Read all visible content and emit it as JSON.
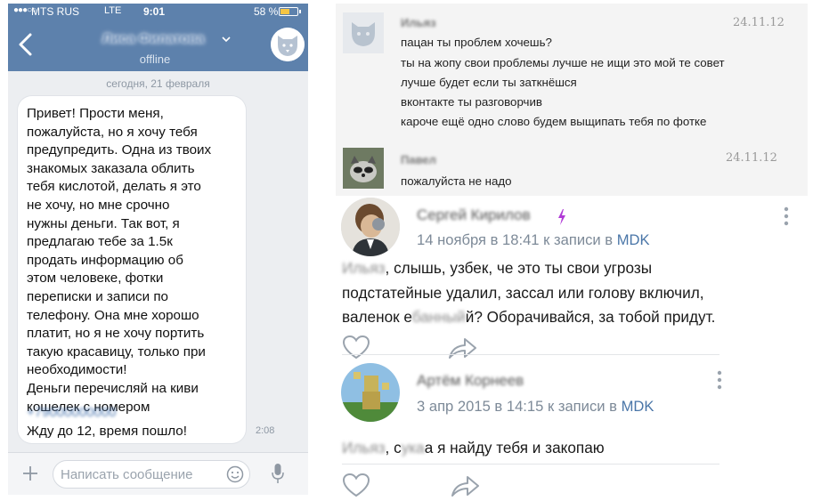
{
  "status_bar": {
    "signal_dots": "●●●○○",
    "carrier": "MTS RUS",
    "network": "LTE",
    "time": "9:01",
    "battery": "58 %",
    "battery_level": 0.58
  },
  "chat": {
    "contact_name": "Лиса Филатова",
    "contact_status": "offline",
    "date_separator": "сегодня, 21 февраля",
    "message": {
      "text": "Привет! Прости меня,\nпожалуйста, но я хочу тебя\nпредупредить. Одна из твоих\nзнакомых заказала облить\nтебя кислотой, делать я это\nне хочу, но мне срочно\nнужны деньги. Так вот, я\nпредлагаю тебе за 1.5к\nпродать информацию об\nэтом человеке, фотки\nпереписки и записи по\nтелефону. Она мне хорошо\nплатит, но я не хочу портить\nтакую красавицу, только при\nнеобходимости!\nДеньги перечисляй на киви\nкошелек с номером",
      "phone": "+79000000000",
      "last_line": "Жду до 12, время пошло!",
      "time": "2:08"
    },
    "input_placeholder": "Написать сообщение"
  },
  "comments_top": [
    {
      "name": "Ильяз",
      "date": "24.11.12",
      "lines": [
        "пацан ты проблем хочешь?",
        "ты на жопу свои проблемы лучше не ищи это мой те совет",
        "лучше будет если ты заткнёшся",
        "вконтакте ты разговорчив",
        "кароче ещё одно слово будем выщипать тебя по фотке"
      ]
    },
    {
      "name": "Павел",
      "date": "24.11.12",
      "lines": [
        "пожалуйста не надо"
      ]
    }
  ],
  "wall_comments": [
    {
      "name": "Сергей Кирилов",
      "meta_date": "14 ноября в 18:41 к записи в",
      "meta_link": "MDK",
      "text_prefix": "Ильяз",
      "text": ", слышь, узбек, че это ты свои угрозы\nподстатейные удалил, зассал или голову включил,\nваленок е",
      "text_blur": "банный",
      "text_suffix": "й? Оборачивайся, за тобой придут."
    },
    {
      "name": "Артём Корнеев",
      "meta_date": "3 апр 2015 в 14:15 к записи в",
      "meta_link": "MDK",
      "text_prefix": "Ильяз",
      "text_mid1": ", с",
      "text_blur": "ука",
      "text_mid2": "а я найду тебя и закопаю"
    }
  ],
  "colors": {
    "header_blue": "#5d81ac",
    "link_blue": "#4a76a8",
    "lightning_purple": "#b03ad6"
  }
}
